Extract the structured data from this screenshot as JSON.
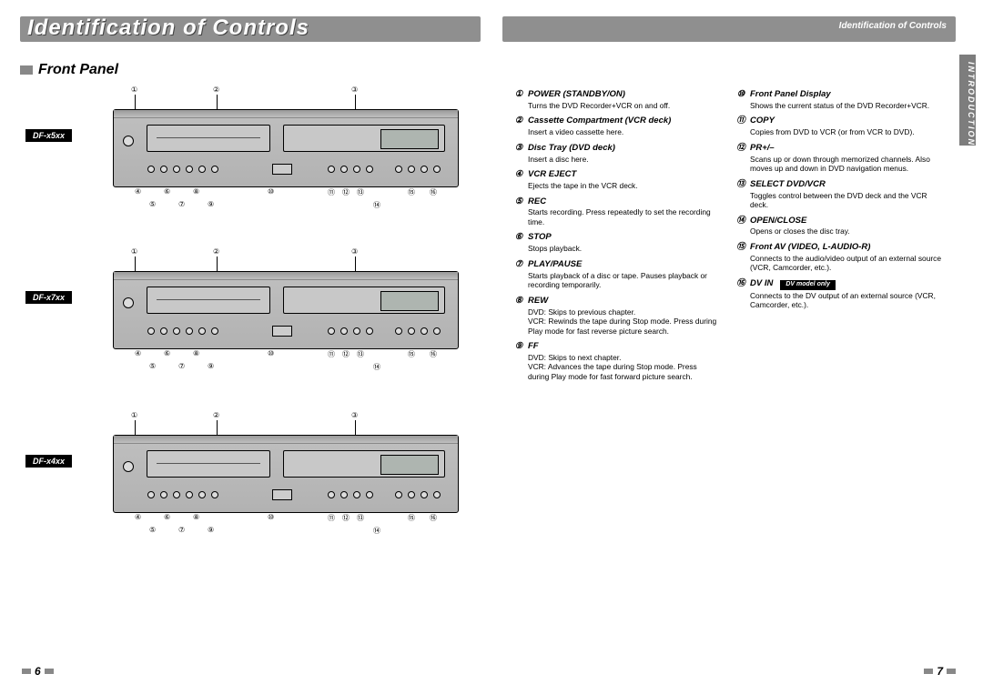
{
  "banner": {
    "title": "Identification of Controls",
    "subtitle": "Identification of Controls"
  },
  "side_tab": "INTRODUCTION",
  "section": "Front Panel",
  "models": [
    "DF-x5xx",
    "DF-x7xx",
    "DF-x4xx"
  ],
  "callout_glyphs": [
    "①",
    "②",
    "③",
    "④",
    "⑤",
    "⑥",
    "⑦",
    "⑧",
    "⑨",
    "⑩",
    "⑪",
    "⑫",
    "⑬",
    "⑭",
    "⑮",
    "⑯"
  ],
  "definitions_left": [
    {
      "n": "①",
      "title": "POWER (STANDBY/ON)",
      "body": "Turns the DVD Recorder+VCR on and off."
    },
    {
      "n": "②",
      "title": "Cassette Compartment (VCR deck)",
      "body": "Insert a video cassette here."
    },
    {
      "n": "③",
      "title": "Disc Tray (DVD deck)",
      "body": "Insert a disc here."
    },
    {
      "n": "④",
      "title": "VCR EJECT",
      "body": "Ejects the tape in the VCR deck."
    },
    {
      "n": "⑤",
      "title": "REC",
      "body": "Starts recording. Press repeatedly to set the recording time."
    },
    {
      "n": "⑥",
      "title": "STOP",
      "body": "Stops playback."
    },
    {
      "n": "⑦",
      "title": "PLAY/PAUSE",
      "body": "Starts playback of a disc or tape. Pauses playback or recording temporarily."
    },
    {
      "n": "⑧",
      "title": "REW",
      "body": "DVD: Skips to previous chapter.\nVCR: Rewinds the tape during Stop mode. Press during Play mode for fast reverse picture search."
    },
    {
      "n": "⑨",
      "title": "FF",
      "body": "DVD: Skips to next chapter.\nVCR: Advances the tape during Stop mode. Press during Play mode for fast forward picture search."
    }
  ],
  "definitions_right": [
    {
      "n": "⑩",
      "title": "Front Panel Display",
      "body": "Shows the current status of the DVD Recorder+VCR."
    },
    {
      "n": "⑪",
      "title": "COPY",
      "body": "Copies from DVD to VCR (or from VCR to DVD)."
    },
    {
      "n": "⑫",
      "title": "PR+/–",
      "body": "Scans up or down through memorized channels. Also moves up and down in DVD navigation menus."
    },
    {
      "n": "⑬",
      "title": "SELECT DVD/VCR",
      "body": "Toggles control between the DVD deck and the VCR deck."
    },
    {
      "n": "⑭",
      "title": "OPEN/CLOSE",
      "body": "Opens or closes the disc tray."
    },
    {
      "n": "⑮",
      "title": "Front AV (VIDEO, L-AUDIO-R)",
      "body": "Connects to the audio/video output of an external source (VCR, Camcorder, etc.)."
    },
    {
      "n": "⑯",
      "title": "DV IN",
      "badge": "DV model only",
      "body": "Connects to the DV output of an external source (VCR, Camcorder, etc.)."
    }
  ],
  "pages": {
    "left": "6",
    "right": "7"
  }
}
